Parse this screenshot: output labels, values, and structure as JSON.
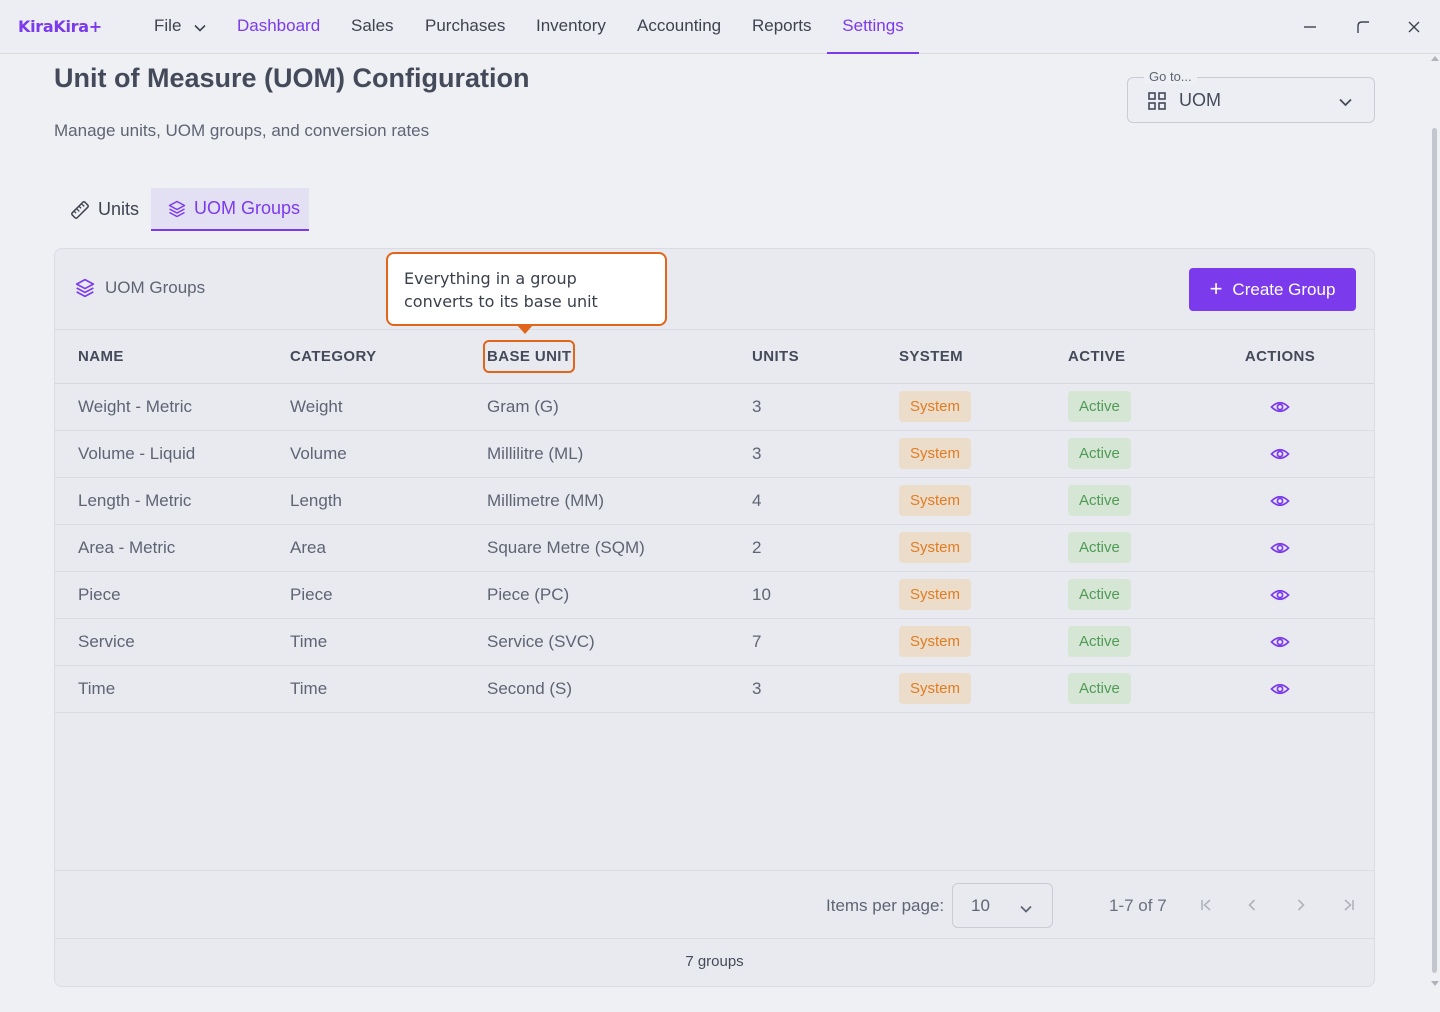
{
  "app": {
    "brand": "KiraKira+"
  },
  "nav": {
    "file": "File",
    "items": [
      "Dashboard",
      "Sales",
      "Purchases",
      "Inventory",
      "Accounting",
      "Reports",
      "Settings"
    ],
    "active": "Settings"
  },
  "header": {
    "title": "Unit of Measure (UOM) Configuration",
    "subtitle": "Manage units, UOM groups, and conversion rates",
    "goto_label": "Go to...",
    "goto_value": "UOM"
  },
  "tabs": [
    {
      "label": "Units",
      "icon": "ruler-icon",
      "active": false
    },
    {
      "label": "UOM Groups",
      "icon": "layers-icon",
      "active": true
    }
  ],
  "card": {
    "title": "UOM Groups",
    "create_label": "Create Group",
    "columns": [
      "NAME",
      "CATEGORY",
      "BASE UNIT",
      "UNITS",
      "SYSTEM",
      "ACTIVE",
      "ACTIONS"
    ],
    "rows": [
      {
        "name": "Weight - Metric",
        "category": "Weight",
        "base_unit": "Gram (G)",
        "units": "3",
        "system": "System",
        "active": "Active"
      },
      {
        "name": "Volume - Liquid",
        "category": "Volume",
        "base_unit": "Millilitre (ML)",
        "units": "3",
        "system": "System",
        "active": "Active"
      },
      {
        "name": "Length - Metric",
        "category": "Length",
        "base_unit": "Millimetre (MM)",
        "units": "4",
        "system": "System",
        "active": "Active"
      },
      {
        "name": "Area - Metric",
        "category": "Area",
        "base_unit": "Square Metre (SQM)",
        "units": "2",
        "system": "System",
        "active": "Active"
      },
      {
        "name": "Piece",
        "category": "Piece",
        "base_unit": "Piece (PC)",
        "units": "10",
        "system": "System",
        "active": "Active"
      },
      {
        "name": "Service",
        "category": "Time",
        "base_unit": "Service (SVC)",
        "units": "7",
        "system": "System",
        "active": "Active"
      },
      {
        "name": "Time",
        "category": "Time",
        "base_unit": "Second (S)",
        "units": "3",
        "system": "System",
        "active": "Active"
      }
    ]
  },
  "pagination": {
    "items_per_page_label": "Items per page:",
    "items_per_page": "10",
    "range": "1-7 of 7"
  },
  "footer": {
    "count": "7 groups"
  },
  "tooltip": {
    "text": "Everything in a group converts to its base unit"
  },
  "colors": {
    "accent": "#7c3aed",
    "highlight": "#e0661b",
    "system_badge": "#e07d23",
    "active_badge": "#4f9a55"
  }
}
